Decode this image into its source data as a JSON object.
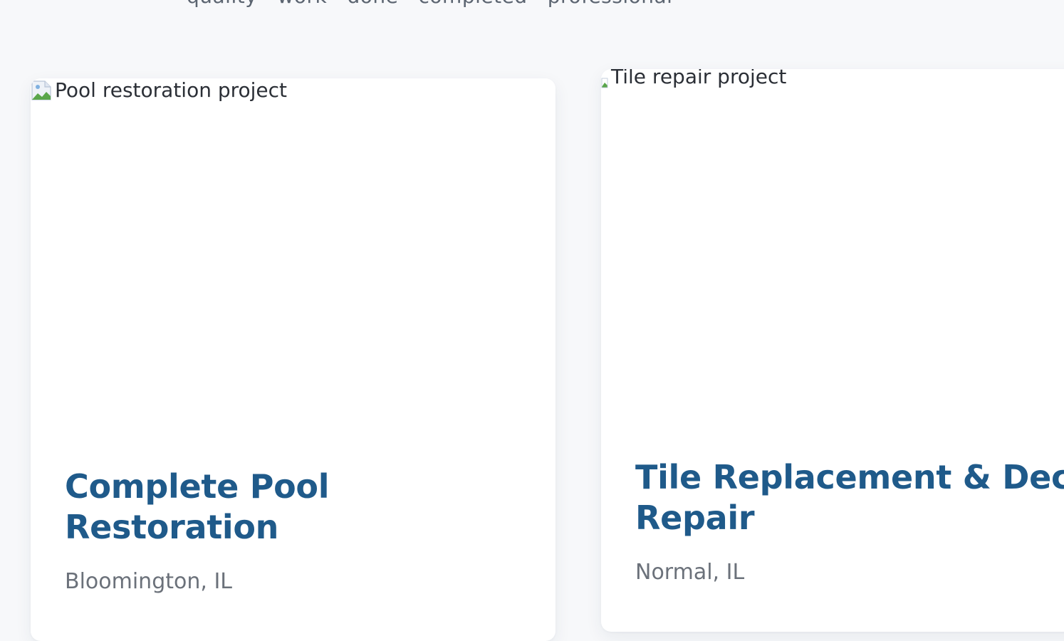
{
  "header": {
    "cut_off_text": "quality · work · done · completed · professional"
  },
  "projects": [
    {
      "image_alt": "Pool restoration project",
      "title": "Complete Pool Restoration",
      "location": "Bloomington, IL"
    },
    {
      "image_alt": "Tile repair project",
      "title": "Tile Replacement & Deck Repair",
      "location": "Normal, IL"
    }
  ],
  "colors": {
    "background": "#f7f8fa",
    "card": "#ffffff",
    "title": "#1f5a8a",
    "location": "#6b717a",
    "alt_text": "#2b2f36"
  }
}
